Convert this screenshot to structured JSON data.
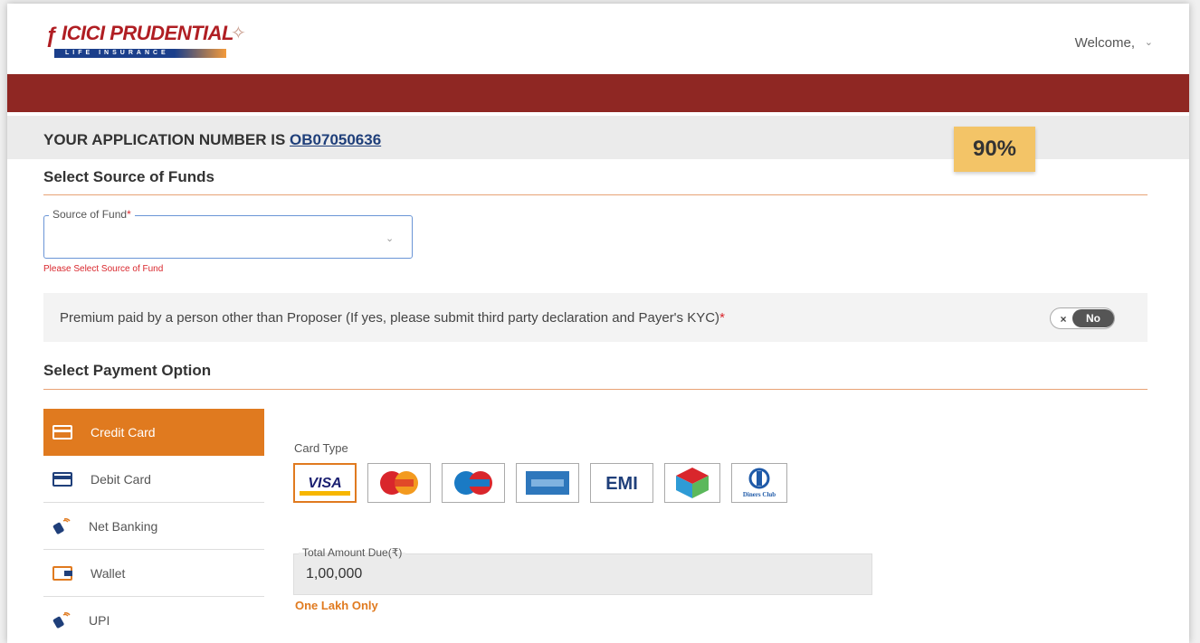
{
  "header": {
    "logo_text": "ICICI PRUDENTIAL",
    "logo_subtext": "LIFE INSURANCE",
    "welcome": "Welcome,"
  },
  "application": {
    "label": "YOUR APPLICATION NUMBER IS",
    "number": "OB07050636"
  },
  "progress": {
    "label": "90%",
    "value": 0.9
  },
  "funds": {
    "title": "Select Source of Funds",
    "field_label": "Source of Fund",
    "field_required": "*",
    "value": "",
    "error": "Please Select Source of Fund"
  },
  "third_party": {
    "text": "Premium paid by a person other than Proposer (If yes, please submit third party declaration and Payer's KYC)",
    "required": "*",
    "toggle_label": "No",
    "toggle_state": false
  },
  "payment": {
    "title": "Select Payment Option",
    "options": [
      {
        "label": "Credit Card",
        "icon": "credit-card-icon",
        "active": true
      },
      {
        "label": "Debit Card",
        "icon": "debit-card-icon",
        "active": false
      },
      {
        "label": "Net Banking",
        "icon": "net-banking-icon",
        "active": false
      },
      {
        "label": "Wallet",
        "icon": "wallet-icon",
        "active": false
      },
      {
        "label": "UPI",
        "icon": "upi-icon",
        "active": false
      }
    ],
    "card_type_label": "Card Type",
    "cards": [
      {
        "name": "VISA",
        "selected": true
      },
      {
        "name": "MasterCard",
        "selected": false
      },
      {
        "name": "Maestro",
        "selected": false
      },
      {
        "name": "American Express",
        "selected": false
      },
      {
        "name": "EMI",
        "selected": false
      },
      {
        "name": "RuPay",
        "selected": false
      },
      {
        "name": "Diners Club",
        "selected": false
      }
    ],
    "amount_label": "Total Amount Due(₹)",
    "amount_value": "1,00,000",
    "amount_words": "One Lakh Only"
  },
  "colors": {
    "brand_red": "#8f2723",
    "accent_orange": "#e07a1f",
    "link_blue": "#1f3f7a",
    "progress_bg": "#f3c467"
  }
}
